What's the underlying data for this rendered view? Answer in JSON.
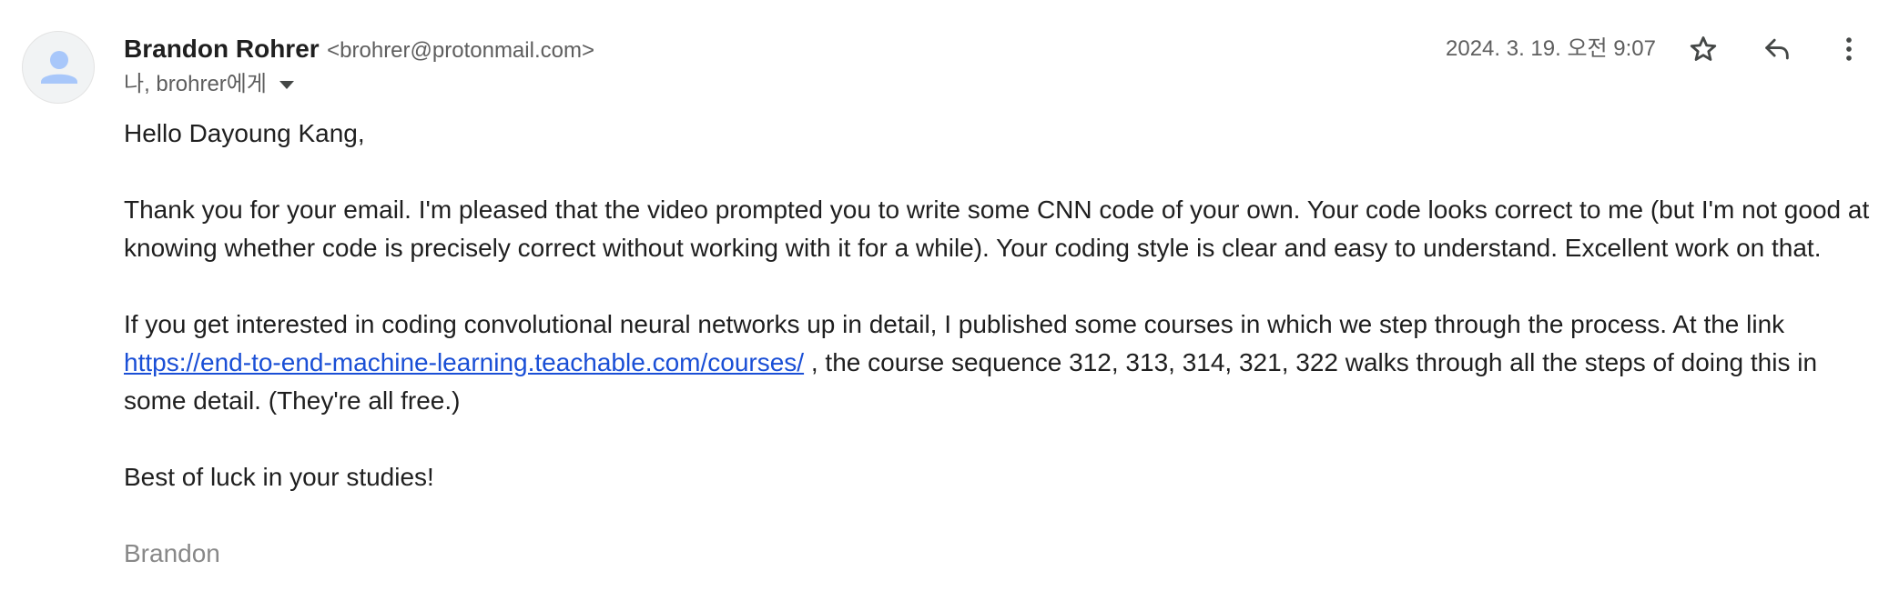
{
  "sender": {
    "name": "Brandon Rohrer",
    "email": "<brohrer@protonmail.com>",
    "recipients": "나, brohrer에게"
  },
  "date": "2024. 3. 19. 오전 9:07",
  "icons": {
    "avatar": "person-icon",
    "star": "star-icon",
    "reply": "reply-icon",
    "more": "more-vert-icon",
    "details": "chevron-down-icon"
  },
  "colors": {
    "link": "#1a4fd6",
    "avatar_fg": "#a8c7fa",
    "avatar_bg": "#f1f3f4"
  },
  "body": {
    "greeting": "Hello Dayoung Kang,",
    "p1": "Thank you for your email. I'm pleased that the video prompted you to write some CNN code of your own. Your code looks correct to me (but I'm not good at knowing whether code is precisely correct without working with it for a while). Your coding style is clear and easy to understand. Excellent work on that.",
    "p2_before": "If you get interested in coding convolutional neural networks up in detail, I published some courses in which we step through the process. At the link ",
    "p2_link": "https://end-to-end-machine-learning.teachable.com/courses/",
    "p2_after": " , the course sequence 312, 313, 314, 321, 322 walks through all the steps of doing this in some detail. (They're all free.)",
    "closing": "Best of luck in your studies!",
    "signature": "Brandon"
  }
}
